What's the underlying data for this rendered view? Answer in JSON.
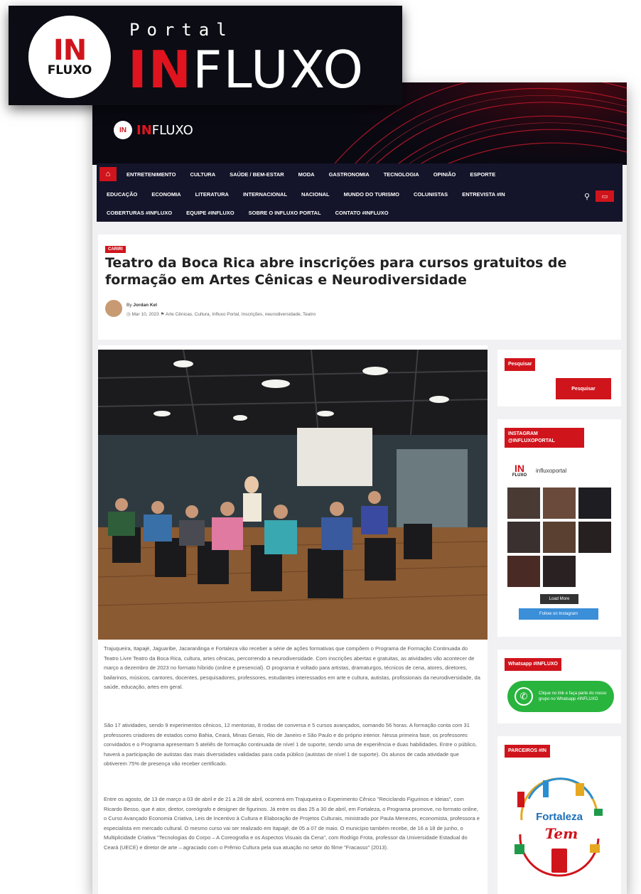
{
  "badge": {
    "logo_in": "IN",
    "logo_fluxo": "FLUXO",
    "portal": "Portal",
    "word_red": "IN",
    "word_white": "FLUXO"
  },
  "site": {
    "logo_in": "IN",
    "logo_red": "IN",
    "logo_white": "FLUXO",
    "nav_row1": [
      "ENTRETENIMENTO",
      "CULTURA",
      "SAÚDE / BEM-ESTAR",
      "MODA",
      "GASTRONOMIA",
      "TECNOLOGIA",
      "OPINIÃO",
      "ESPORTE"
    ],
    "nav_row2": [
      "EDUCAÇÃO",
      "ECONOMIA",
      "LITERATURA",
      "INTERNACIONAL",
      "NACIONAL",
      "MUNDO DO TURISMO",
      "COLUNISTAS",
      "ENTREVISTA #IN"
    ],
    "nav_row3": [
      "COBERTURAS #INFLUXO",
      "EQUIPE #INFLUXO",
      "SOBRE O INFLUXO PORTAL",
      "CONTATO #INFLUXO"
    ],
    "home_icon": "home-icon",
    "search_icon": "search-icon",
    "accent": "#d0141c",
    "nav_bg": "#14142a"
  },
  "article": {
    "category": "CARIRI",
    "title": "Teatro da Boca Rica abre inscrições para cursos gratuitos de formação em Artes Cênicas e Neurodiversidade",
    "author": "Jordan Kel",
    "date": "Mar 10, 2023",
    "tags": "Arte Cênicas, Cultura, Influxo Portal, Inscrições, neurodiversidade, Teatro",
    "paragraphs": [
      "Trajuqueira, Itapajé, Jaguaribe, Jacaranãnga e Fortaleza vão receber a série de ações formativas que compõem o Programa de Formação Continuada do Teatro Livre Teatro da Boca Rica, cultura, artes cênicas, percorrendo a neurodiversidade. Com inscrições abertas e gratuitas, as atividades vão acontecer de março a dezembro de 2023 no formato híbrido (online e presencial). O programa é voltado para artistas, dramaturgos, técnicos de cena, atores, diretores, bailarinos, músicos, cantores, docentes, pesquisadores, professores, estudantes interessados em arte e cultura, autistas, profissionais da neurodiversidade, da saúde, educação, artes em geral.",
      "São 17 atividades, sendo 9 experimentos cênicos, 12 mentorias, 8 rodas de conversa e 5 cursos avançados, somando 56 horas. A formação conta com 31 professores criadores de estados como Bahia, Ceará, Minas Gerais, Rio de Janeiro e São Paulo e do próprio interior. Nessa primeira fase, os professores convidados e o Programa apresentam 5 ateliês de formação continuada de nível 1 de suporte, sendo uma de experiência e duas habilidades. Entre o público, haverá a participação de autistas das mais diversidades validadas para cada público (autistas de nível 1 de suporte). Os alunos de cada atividade que obtiverem 75% de presença vão receber certificado.",
      "Entre os agosto, de 13 de março a 03 de abril e de 21 a 28 de abril, ocorrerá em Trajuqueira o Experimento Cênico \"Reciclando Figurinos e Ideias\", com Ricardo Besso, que é ator, diretor, coreógrafo e designer de figurinos. Já entre os dias 25 a 30 de abril, em Fortaleza, o Programa promove, no formato online, o Curso Avançado Economia Criativa, Leis de Incentivo à Cultura e Elaboração de Projetos Culturais, ministrado por Paula Menezes, economista, professora e especialista em mercado cultural. O mesmo curso vai ser realizado em Itapajé, de 05 a 07 de maio. O município também recebe, de 16 a 18 de junho, o Multiplicidade Criativa \"Tecnologias do Corpo – A Coreografia e os Aspectos Visuais da Cena\", com Rodrigo Frota, professor da Universidade Estadual do Ceará (UECE) e diretor de arte – agraciado com o Prêmio Cultura pela sua atuação no setor do filme \"Fracasso\" (2013)."
    ]
  },
  "sidebar": {
    "search_title": "Pesquisar",
    "search_button": "Pesquisar",
    "instagram_title": "INSTAGRAM @INFLUXOPORTAL",
    "instagram_in": "IN",
    "instagram_fluxo": "FLUXO",
    "instagram_handle": "influxoportal",
    "load_more": "Load More",
    "follow_button": "Follow on Instagram",
    "whatsapp_title": "Whatsapp #INFLUXO",
    "whatsapp_text": "Clique no link e faça parte do nosso grupo no Whatsapp #INFLUXO",
    "partners_title": "PARCEIROS #IN",
    "partner_name": "Fortaleza",
    "partner_tag": "Tem"
  }
}
